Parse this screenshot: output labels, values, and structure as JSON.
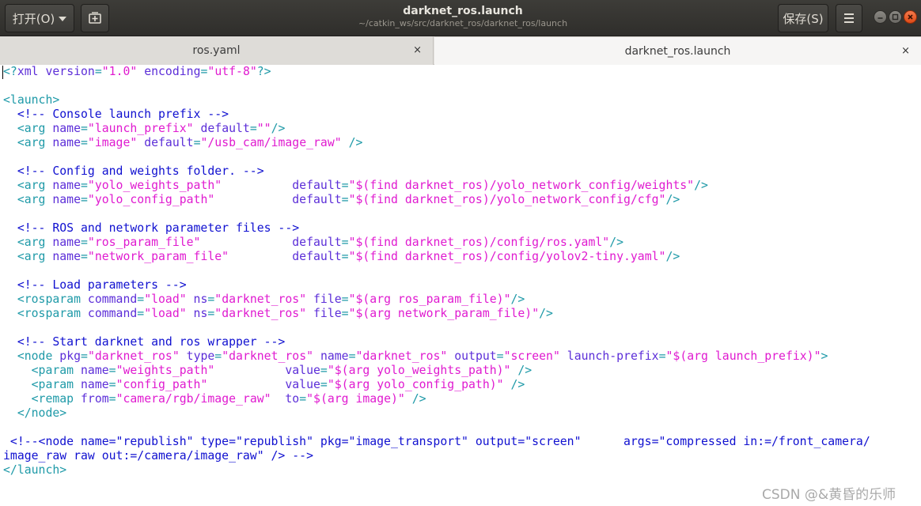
{
  "header": {
    "open_label": "打开(O)",
    "title": "darknet_ros.launch",
    "path": "~/catkin_ws/src/darknet_ros/darknet_ros/launch",
    "save_label": "保存(S)"
  },
  "tabs": [
    {
      "label": "ros.yaml",
      "close": "×"
    },
    {
      "label": "darknet_ros.launch",
      "close": "×"
    }
  ],
  "code": {
    "lines": [
      [
        [
          "t",
          "<?"
        ],
        [
          "a",
          "xml "
        ],
        [
          "a",
          "version"
        ],
        [
          "t",
          "="
        ],
        [
          "s",
          "\"1.0\""
        ],
        [
          "a",
          " encoding"
        ],
        [
          "t",
          "="
        ],
        [
          "s",
          "\"utf-8\""
        ],
        [
          "t",
          "?>"
        ]
      ],
      [],
      [
        [
          "t",
          "<launch>"
        ]
      ],
      [
        [
          "c",
          "  <!-- Console launch prefix -->"
        ]
      ],
      [
        [
          "t",
          "  <arg "
        ],
        [
          "a",
          "name"
        ],
        [
          "t",
          "="
        ],
        [
          "s",
          "\"launch_prefix\""
        ],
        [
          "a",
          " default"
        ],
        [
          "t",
          "="
        ],
        [
          "s",
          "\"\""
        ],
        [
          "t",
          "/>"
        ]
      ],
      [
        [
          "t",
          "  <arg "
        ],
        [
          "a",
          "name"
        ],
        [
          "t",
          "="
        ],
        [
          "s",
          "\"image\""
        ],
        [
          "a",
          " default"
        ],
        [
          "t",
          "="
        ],
        [
          "s",
          "\"/usb_cam/image_raw\""
        ],
        [
          "t",
          " />"
        ]
      ],
      [],
      [
        [
          "c",
          "  <!-- Config and weights folder. -->"
        ]
      ],
      [
        [
          "t",
          "  <arg "
        ],
        [
          "a",
          "name"
        ],
        [
          "t",
          "="
        ],
        [
          "s",
          "\"yolo_weights_path\""
        ],
        [
          "a",
          "          default"
        ],
        [
          "t",
          "="
        ],
        [
          "s",
          "\"$(find darknet_ros)/yolo_network_config/weights\""
        ],
        [
          "t",
          "/>"
        ]
      ],
      [
        [
          "t",
          "  <arg "
        ],
        [
          "a",
          "name"
        ],
        [
          "t",
          "="
        ],
        [
          "s",
          "\"yolo_config_path\""
        ],
        [
          "a",
          "           default"
        ],
        [
          "t",
          "="
        ],
        [
          "s",
          "\"$(find darknet_ros)/yolo_network_config/cfg\""
        ],
        [
          "t",
          "/>"
        ]
      ],
      [],
      [
        [
          "c",
          "  <!-- ROS and network parameter files -->"
        ]
      ],
      [
        [
          "t",
          "  <arg "
        ],
        [
          "a",
          "name"
        ],
        [
          "t",
          "="
        ],
        [
          "s",
          "\"ros_param_file\""
        ],
        [
          "a",
          "             default"
        ],
        [
          "t",
          "="
        ],
        [
          "s",
          "\"$(find darknet_ros)/config/ros.yaml\""
        ],
        [
          "t",
          "/>"
        ]
      ],
      [
        [
          "t",
          "  <arg "
        ],
        [
          "a",
          "name"
        ],
        [
          "t",
          "="
        ],
        [
          "s",
          "\"network_param_file\""
        ],
        [
          "a",
          "         default"
        ],
        [
          "t",
          "="
        ],
        [
          "s",
          "\"$(find darknet_ros)/config/yolov2-tiny.yaml\""
        ],
        [
          "t",
          "/>"
        ]
      ],
      [],
      [
        [
          "c",
          "  <!-- Load parameters -->"
        ]
      ],
      [
        [
          "t",
          "  <rosparam "
        ],
        [
          "a",
          "command"
        ],
        [
          "t",
          "="
        ],
        [
          "s",
          "\"load\""
        ],
        [
          "a",
          " ns"
        ],
        [
          "t",
          "="
        ],
        [
          "s",
          "\"darknet_ros\""
        ],
        [
          "a",
          " file"
        ],
        [
          "t",
          "="
        ],
        [
          "s",
          "\"$(arg ros_param_file)\""
        ],
        [
          "t",
          "/>"
        ]
      ],
      [
        [
          "t",
          "  <rosparam "
        ],
        [
          "a",
          "command"
        ],
        [
          "t",
          "="
        ],
        [
          "s",
          "\"load\""
        ],
        [
          "a",
          " ns"
        ],
        [
          "t",
          "="
        ],
        [
          "s",
          "\"darknet_ros\""
        ],
        [
          "a",
          " file"
        ],
        [
          "t",
          "="
        ],
        [
          "s",
          "\"$(arg network_param_file)\""
        ],
        [
          "t",
          "/>"
        ]
      ],
      [],
      [
        [
          "c",
          "  <!-- Start darknet and ros wrapper -->"
        ]
      ],
      [
        [
          "t",
          "  <node "
        ],
        [
          "a",
          "pkg"
        ],
        [
          "t",
          "="
        ],
        [
          "s",
          "\"darknet_ros\""
        ],
        [
          "a",
          " type"
        ],
        [
          "t",
          "="
        ],
        [
          "s",
          "\"darknet_ros\""
        ],
        [
          "a",
          " name"
        ],
        [
          "t",
          "="
        ],
        [
          "s",
          "\"darknet_ros\""
        ],
        [
          "a",
          " output"
        ],
        [
          "t",
          "="
        ],
        [
          "s",
          "\"screen\""
        ],
        [
          "a",
          " launch-prefix"
        ],
        [
          "t",
          "="
        ],
        [
          "s",
          "\"$(arg launch_prefix)\""
        ],
        [
          "t",
          ">"
        ]
      ],
      [
        [
          "t",
          "    <param "
        ],
        [
          "a",
          "name"
        ],
        [
          "t",
          "="
        ],
        [
          "s",
          "\"weights_path\""
        ],
        [
          "a",
          "          value"
        ],
        [
          "t",
          "="
        ],
        [
          "s",
          "\"$(arg yolo_weights_path)\""
        ],
        [
          "t",
          " />"
        ]
      ],
      [
        [
          "t",
          "    <param "
        ],
        [
          "a",
          "name"
        ],
        [
          "t",
          "="
        ],
        [
          "s",
          "\"config_path\""
        ],
        [
          "a",
          "           value"
        ],
        [
          "t",
          "="
        ],
        [
          "s",
          "\"$(arg yolo_config_path)\""
        ],
        [
          "t",
          " />"
        ]
      ],
      [
        [
          "t",
          "    <remap "
        ],
        [
          "a",
          "from"
        ],
        [
          "t",
          "="
        ],
        [
          "s",
          "\"camera/rgb/image_raw\""
        ],
        [
          "a",
          "  to"
        ],
        [
          "t",
          "="
        ],
        [
          "s",
          "\"$(arg image)\""
        ],
        [
          "t",
          " />"
        ]
      ],
      [
        [
          "t",
          "  </node>"
        ]
      ],
      [],
      [
        [
          "c",
          " <!--<node name=\"republish\" type=\"republish\" pkg=\"image_transport\" output=\"screen\"      args=\"compressed in:=/front_camera/"
        ]
      ],
      [
        [
          "c",
          "image_raw raw out:=/camera/image_raw\" /> -->"
        ]
      ],
      [
        [
          "t",
          "</launch>"
        ]
      ]
    ]
  },
  "watermark": "CSDN @&黄昏的乐师",
  "colors": {
    "tag": "#1f9aa8",
    "attribute": "#5c2ed8",
    "string": "#e01bd0",
    "comment": "#1010d0"
  }
}
